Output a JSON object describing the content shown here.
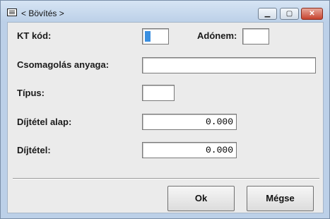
{
  "window": {
    "title": "< Bövítés >",
    "controls": {
      "minimize": "▁",
      "maximize": "▢",
      "close": "✕"
    }
  },
  "form": {
    "kt_kod_label": "KT kód:",
    "kt_kod_value": "",
    "adonem_label": "Adónem:",
    "adonem_value": "",
    "csomagolas_label": "Csomagolás anyaga:",
    "csomagolas_value": "",
    "tipus_label": "Típus:",
    "tipus_value": "",
    "dijtetel_alap_label": "Díjtétel alap:",
    "dijtetel_alap_value": "0.000",
    "dijtetel_label": "Díjtétel:",
    "dijtetel_value": "0.000"
  },
  "buttons": {
    "ok_label": "Ok",
    "cancel_label": "Mégse"
  }
}
